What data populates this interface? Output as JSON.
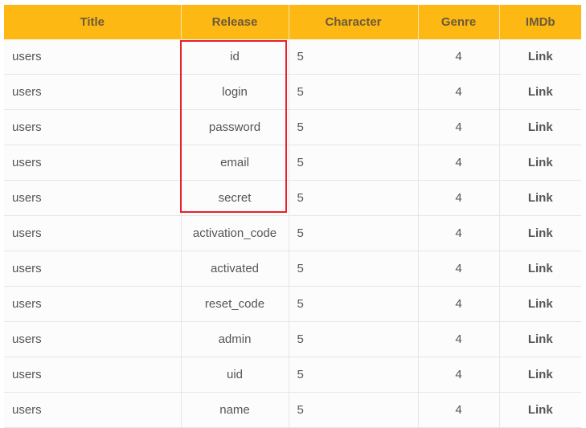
{
  "table": {
    "headers": [
      "Title",
      "Release",
      "Character",
      "Genre",
      "IMDb"
    ],
    "rows": [
      {
        "title": "users",
        "release": "id",
        "character": "5",
        "genre": "4",
        "imdb": "Link"
      },
      {
        "title": "users",
        "release": "login",
        "character": "5",
        "genre": "4",
        "imdb": "Link"
      },
      {
        "title": "users",
        "release": "password",
        "character": "5",
        "genre": "4",
        "imdb": "Link"
      },
      {
        "title": "users",
        "release": "email",
        "character": "5",
        "genre": "4",
        "imdb": "Link"
      },
      {
        "title": "users",
        "release": "secret",
        "character": "5",
        "genre": "4",
        "imdb": "Link"
      },
      {
        "title": "users",
        "release": "activation_code",
        "character": "5",
        "genre": "4",
        "imdb": "Link"
      },
      {
        "title": "users",
        "release": "activated",
        "character": "5",
        "genre": "4",
        "imdb": "Link"
      },
      {
        "title": "users",
        "release": "reset_code",
        "character": "5",
        "genre": "4",
        "imdb": "Link"
      },
      {
        "title": "users",
        "release": "admin",
        "character": "5",
        "genre": "4",
        "imdb": "Link"
      },
      {
        "title": "users",
        "release": "uid",
        "character": "5",
        "genre": "4",
        "imdb": "Link"
      },
      {
        "title": "users",
        "release": "name",
        "character": "5",
        "genre": "4",
        "imdb": "Link"
      }
    ]
  },
  "colors": {
    "header_background": "#fdb813",
    "highlight_border": "#e8202a"
  }
}
